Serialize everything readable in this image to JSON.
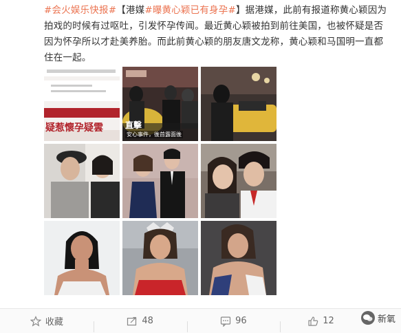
{
  "post": {
    "hashtag_1": "#会火娱乐快报#",
    "bracket_open": "【",
    "hashtag_2_pre": "港媒",
    "hashtag_2": "#曝黄心颖已有身孕#",
    "bracket_close": "】",
    "body": "据港媒，此前有报道称黄心颖因为拍戏的时候有过呕吐，引发怀孕传闻。最近黄心颖被拍到前往美国，也被怀疑是否因为怀孕所以才赴美养胎。而此前黄心颖的朋友唐文龙称，黄心颖和马国明一直都住在一起。"
  },
  "images": [
    {
      "caption": "疑惹懷孕疑雲"
    },
    {
      "caption_top": "直擊",
      "caption_sub": "安心事件，後首露面後"
    },
    {
      "caption": ""
    },
    {
      "caption": ""
    },
    {
      "caption": ""
    },
    {
      "caption": ""
    },
    {
      "caption": ""
    },
    {
      "caption": ""
    },
    {
      "caption": ""
    }
  ],
  "footer": {
    "collect_label": "收藏",
    "repost_count": "48",
    "comment_count": "96",
    "like_count": "12"
  },
  "watermark": {
    "label": "新氧"
  },
  "colors": {
    "accent": "#eb7350",
    "text": "#333333"
  }
}
